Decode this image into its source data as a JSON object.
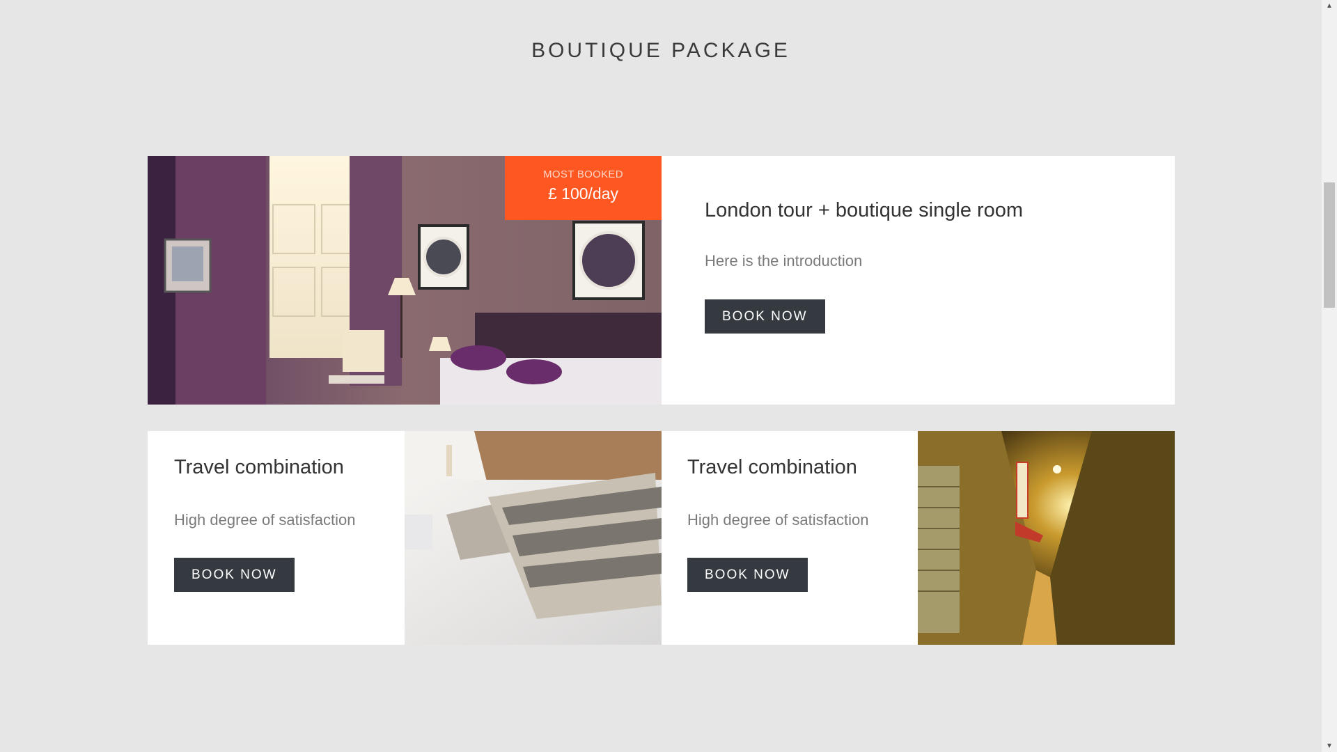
{
  "section": {
    "title": "BOUTIQUE PACKAGE"
  },
  "featured": {
    "badge_label": "MOST BOOKED",
    "price": "£ 100/day",
    "title": "London tour + boutique single room",
    "intro": "Here is the introduction",
    "button": "BOOK NOW"
  },
  "combos": [
    {
      "title": "Travel combination",
      "text": "High degree of satisfaction",
      "button": "BOOK NOW"
    },
    {
      "title": "Travel combination",
      "text": "High degree of satisfaction",
      "button": "BOOK NOW"
    }
  ],
  "colors": {
    "background": "#e6e6e6",
    "badge": "#ff5722",
    "button": "#343a40"
  },
  "icons": {
    "scroll_up": "chevron-up-icon",
    "scroll_down": "chevron-down-icon"
  }
}
